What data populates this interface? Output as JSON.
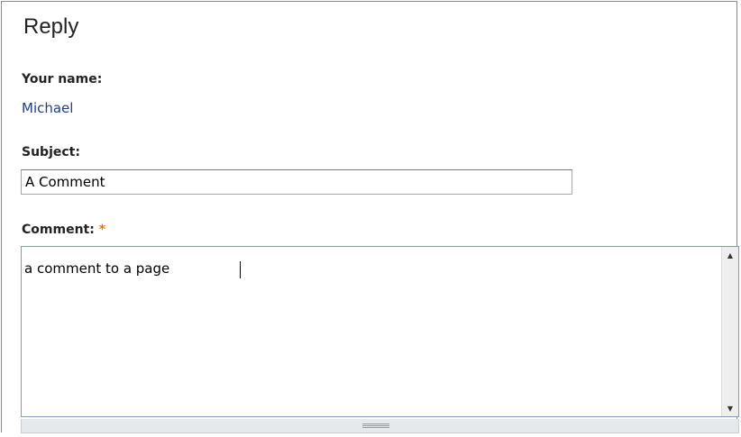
{
  "form": {
    "title": "Reply",
    "name_label": "Your name:",
    "name_value": "Michael",
    "subject_label": "Subject:",
    "subject_value": "A Comment",
    "comment_label": "Comment:",
    "required_marker": "*",
    "comment_value": "a comment to a page"
  },
  "colors": {
    "name_link": "#1f3f8a",
    "required_marker": "#e07b00",
    "textarea_border": "#7f9db9"
  },
  "icons": {
    "scroll_up": "arrow-up-icon",
    "scroll_down": "arrow-down-icon",
    "resize_grip": "grip-icon"
  }
}
